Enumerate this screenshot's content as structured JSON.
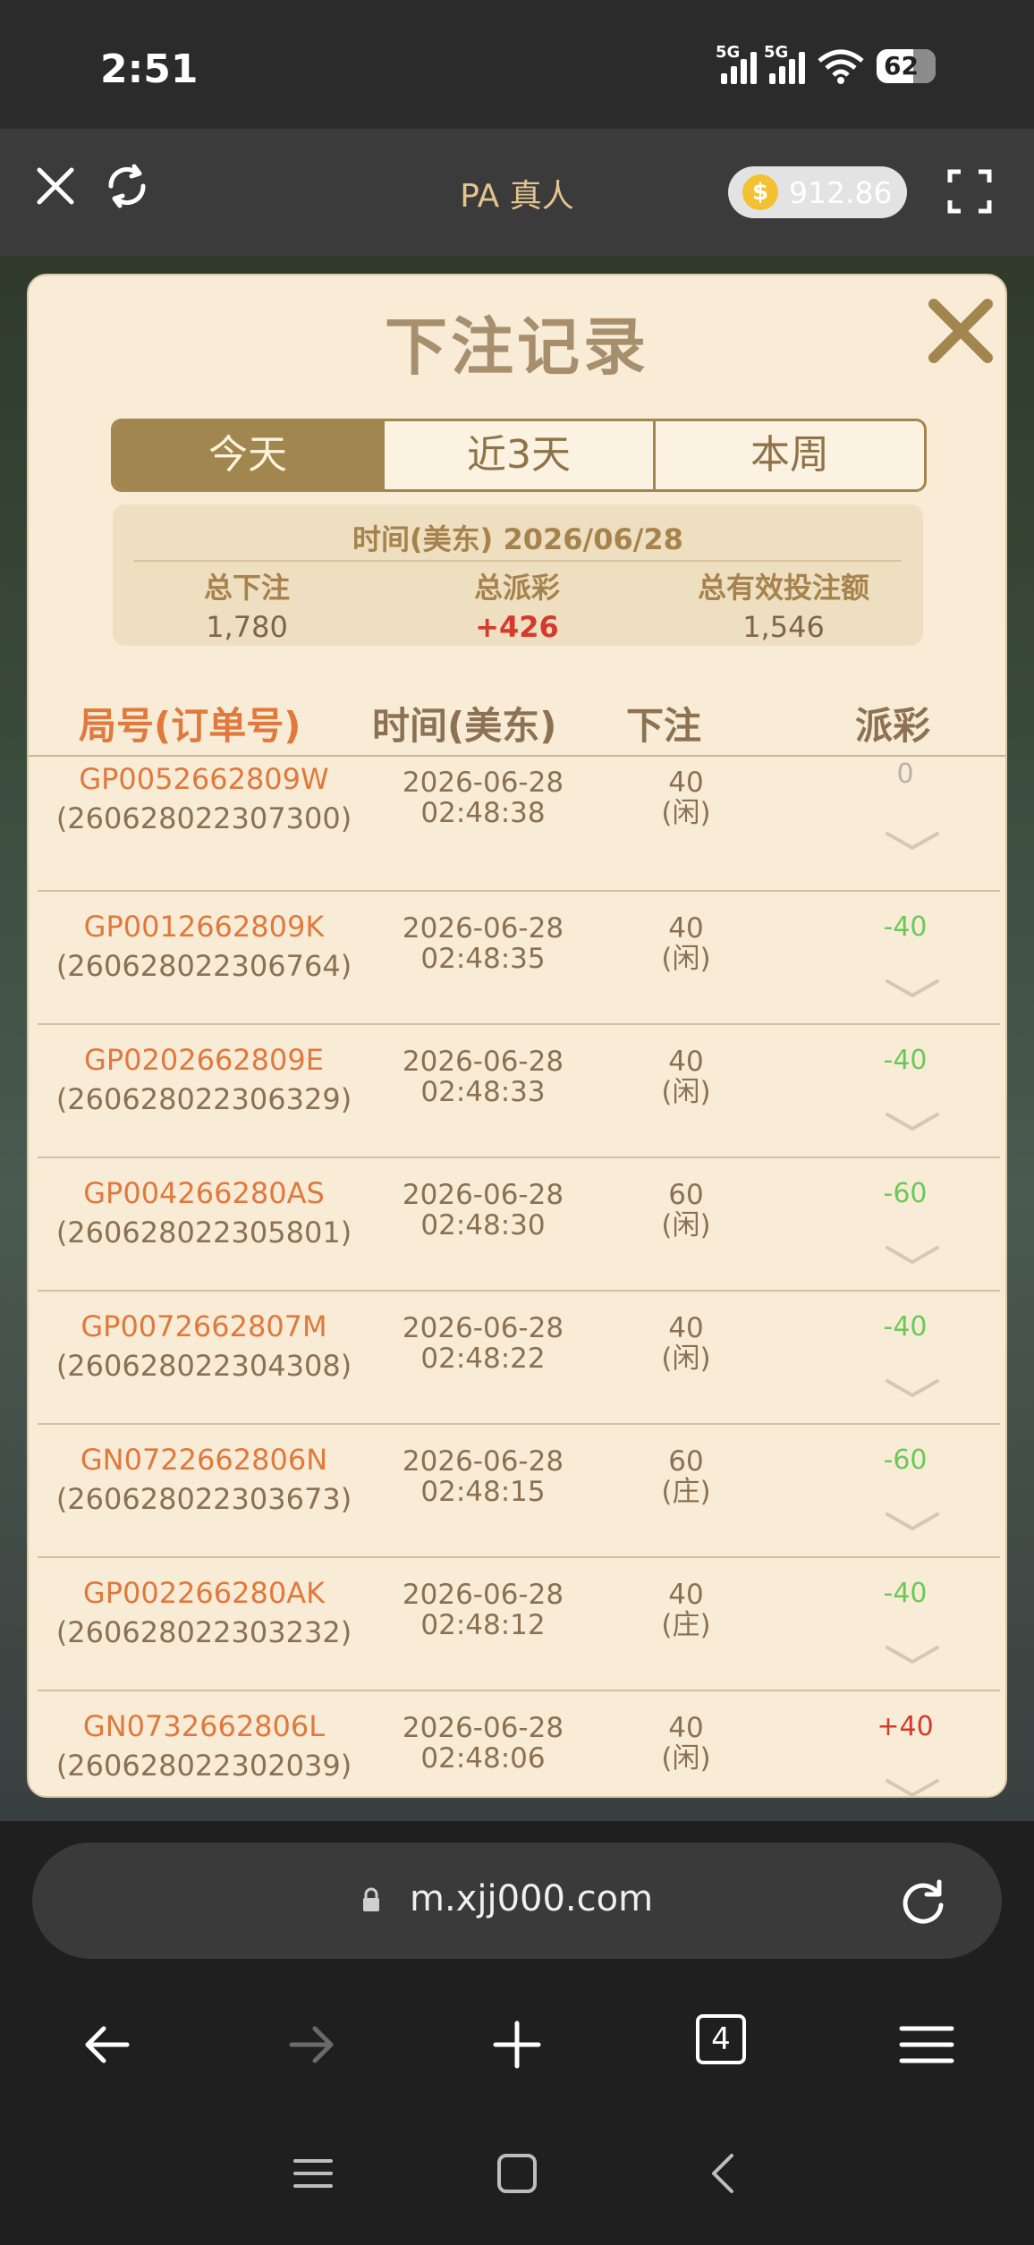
{
  "status_bar": {
    "time": "2:51",
    "network_1": "5G",
    "network_2": "5G",
    "battery": "62"
  },
  "header": {
    "title": "PA 真人",
    "balance": "912.86",
    "coin_symbol": "$"
  },
  "modal": {
    "title": "下注记录",
    "tabs": [
      {
        "label": "今天",
        "active": true
      },
      {
        "label": "近3天",
        "active": false
      },
      {
        "label": "本周",
        "active": false
      }
    ],
    "summary": {
      "date_label": "时间(美东) 2026/06/28",
      "total_bet_label": "总下注",
      "total_bet": "1,780",
      "total_payout_label": "总派彩",
      "total_payout": "+426",
      "total_valid_label": "总有效投注额",
      "total_valid": "1,546"
    },
    "columns": [
      "局号(订单号)",
      "时间(美东)",
      "下注",
      "派彩"
    ],
    "rows": [
      {
        "id": "GP0052662809W",
        "order": "(260628022307300)",
        "date": "2026-06-28",
        "time": "02:48:38",
        "bet": "40",
        "side": "(闲)",
        "payout": "0",
        "type": "zero"
      },
      {
        "id": "GP0012662809K",
        "order": "(260628022306764)",
        "date": "2026-06-28",
        "time": "02:48:35",
        "bet": "40",
        "side": "(闲)",
        "payout": "-40",
        "type": "neg"
      },
      {
        "id": "GP0202662809E",
        "order": "(260628022306329)",
        "date": "2026-06-28",
        "time": "02:48:33",
        "bet": "40",
        "side": "(闲)",
        "payout": "-40",
        "type": "neg"
      },
      {
        "id": "GP004266280AS",
        "order": "(260628022305801)",
        "date": "2026-06-28",
        "time": "02:48:30",
        "bet": "60",
        "side": "(闲)",
        "payout": "-60",
        "type": "neg"
      },
      {
        "id": "GP0072662807M",
        "order": "(260628022304308)",
        "date": "2026-06-28",
        "time": "02:48:22",
        "bet": "40",
        "side": "(闲)",
        "payout": "-40",
        "type": "neg"
      },
      {
        "id": "GN0722662806N",
        "order": "(260628022303673)",
        "date": "2026-06-28",
        "time": "02:48:15",
        "bet": "60",
        "side": "(庄)",
        "payout": "-60",
        "type": "neg"
      },
      {
        "id": "GP002266280AK",
        "order": "(260628022303232)",
        "date": "2026-06-28",
        "time": "02:48:12",
        "bet": "40",
        "side": "(庄)",
        "payout": "-40",
        "type": "neg"
      },
      {
        "id": "GN0732662806L",
        "order": "(260628022302039)",
        "date": "2026-06-28",
        "time": "02:48:06",
        "bet": "40",
        "side": "(闲)",
        "payout": "+40",
        "type": "posv"
      }
    ]
  },
  "browser": {
    "url": "m.xjj000.com",
    "tab_count": "4"
  }
}
